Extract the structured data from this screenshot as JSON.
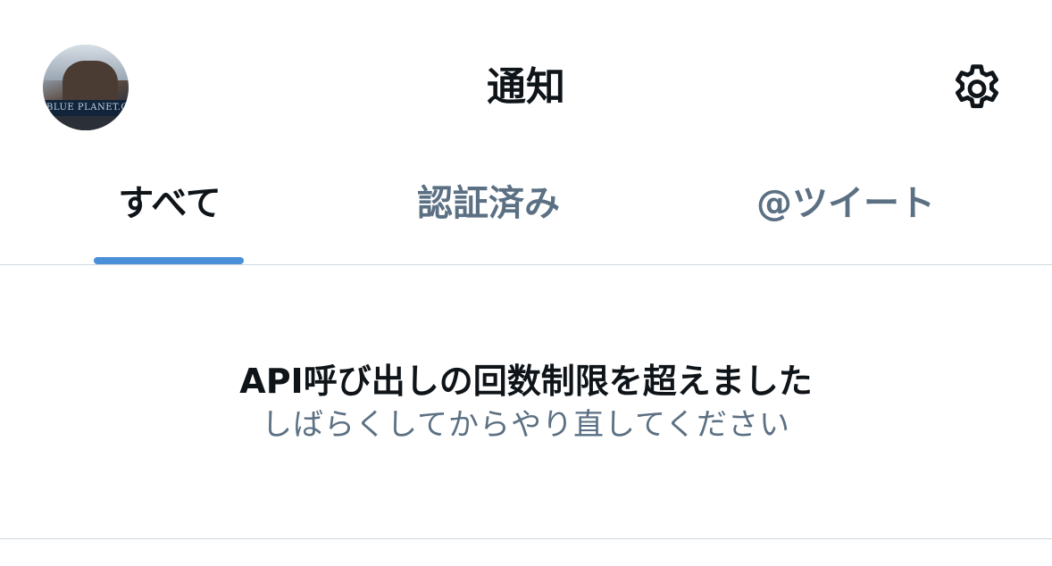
{
  "header": {
    "title": "通知",
    "avatar_sign_text": "BLUE PLANET.ORG",
    "settings_icon": "gear-icon"
  },
  "tabs": [
    {
      "label": "すべて",
      "active": true
    },
    {
      "label": "認証済み",
      "active": false
    },
    {
      "label": "@ツイート",
      "active": false
    }
  ],
  "message": {
    "title": "API呼び出しの回数制限を超えました",
    "subtitle": "しばらくしてからやり直してください"
  },
  "colors": {
    "accent": "#4a90d9",
    "text_primary": "#0f1419",
    "text_secondary": "#5b7083",
    "divider": "#cfd9de"
  }
}
